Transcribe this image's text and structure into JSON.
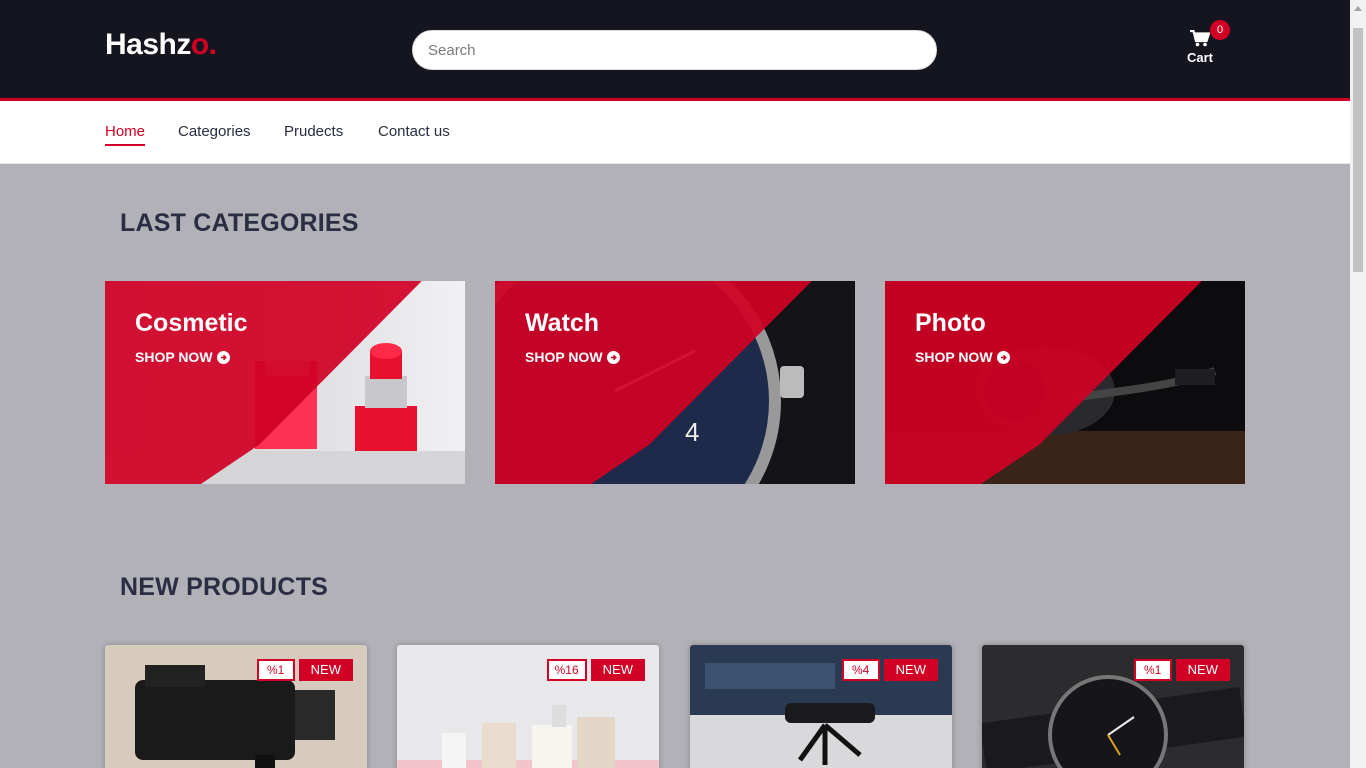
{
  "header": {
    "logo_main": "Hashz",
    "logo_accent": "o.",
    "search_placeholder": "Search",
    "cart_label": "Cart",
    "cart_count": "0"
  },
  "nav": {
    "items": [
      "Home",
      "Categories",
      "Prudects",
      "Contact us"
    ],
    "active": "Home"
  },
  "sections": {
    "categories_title": "LAST CATEGORIES",
    "products_title": "NEW PRODUCTS"
  },
  "categories": [
    {
      "title": "Cosmetic",
      "link": "SHOP NOW"
    },
    {
      "title": "Watch",
      "link": "SHOP NOW"
    },
    {
      "title": "Photo",
      "link": "SHOP NOW"
    }
  ],
  "products": [
    {
      "sale": "%1",
      "badge": "NEW"
    },
    {
      "sale": "%16",
      "badge": "NEW"
    },
    {
      "sale": "%4",
      "badge": "NEW"
    },
    {
      "sale": "%1",
      "badge": "NEW"
    }
  ],
  "colors": {
    "accent": "#d10024",
    "header_bg": "#15151f",
    "body_bg": "#b1b1b7",
    "text_dark": "#2b2d42"
  }
}
